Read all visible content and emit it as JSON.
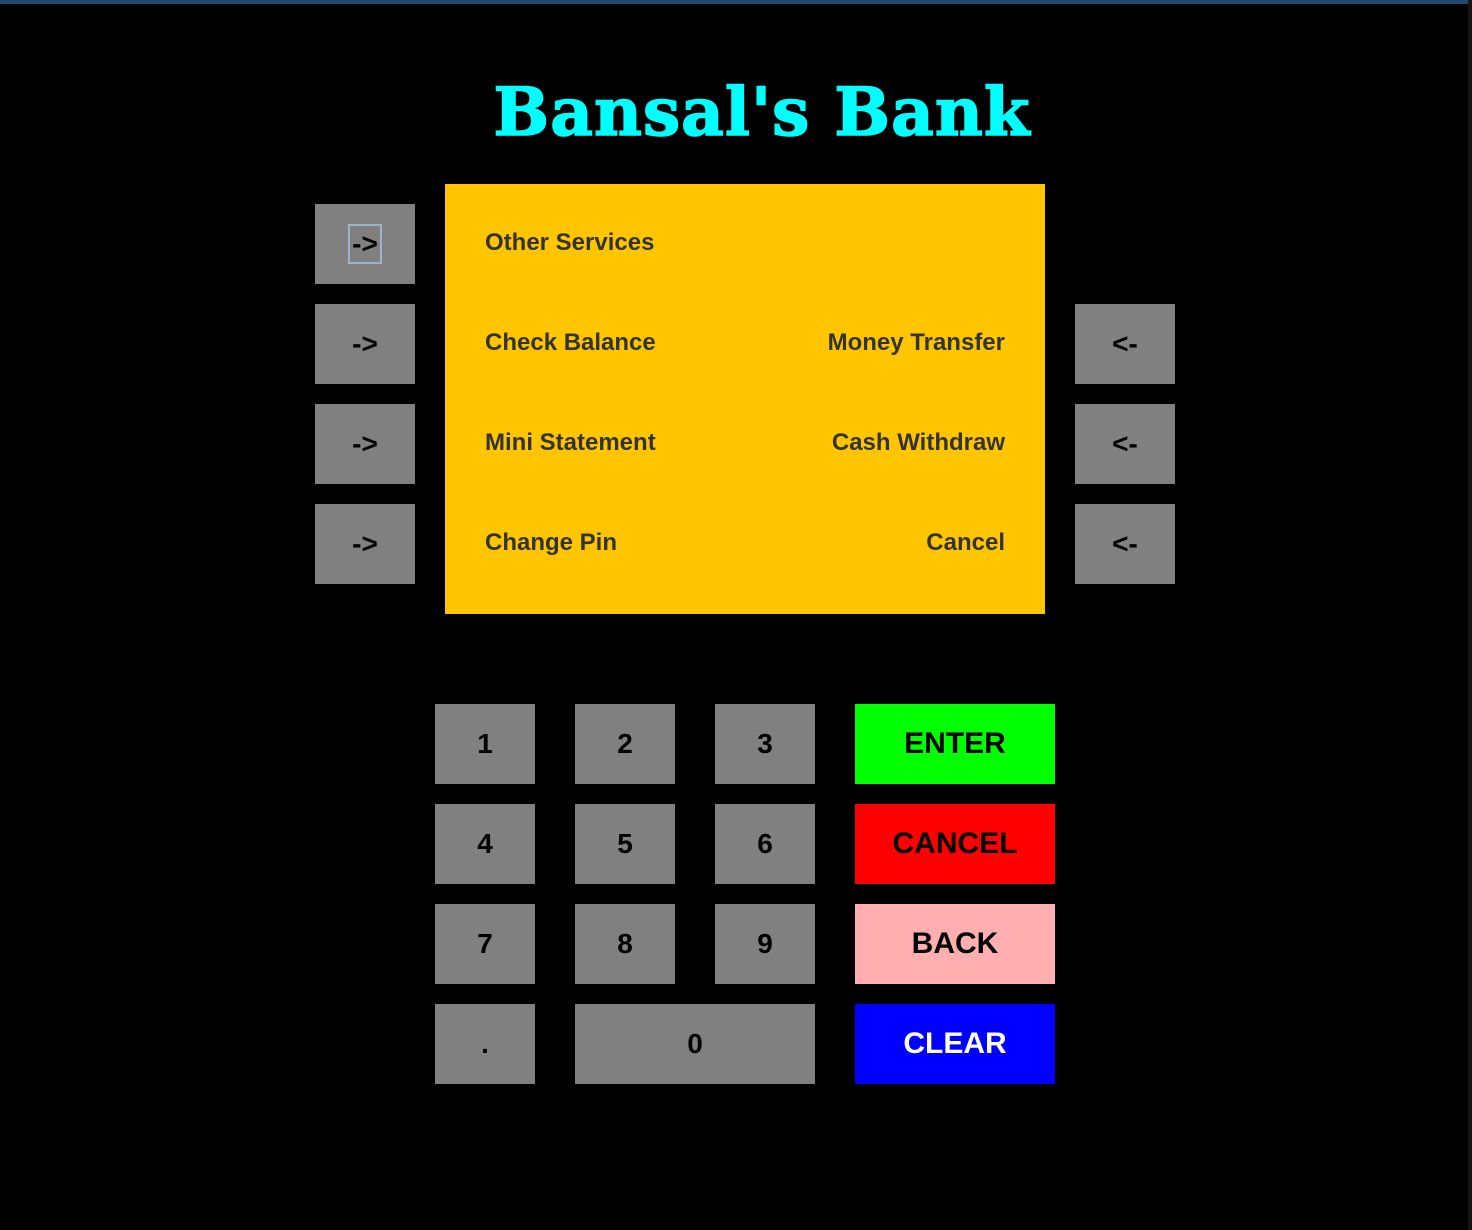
{
  "title": "Bansal's Bank",
  "screen": {
    "options": {
      "left_1": "Other Services",
      "left_2": "Check Balance",
      "left_3": "Mini Statement",
      "left_4": "Change Pin",
      "right_2": "Money Transfer",
      "right_3": "Cash Withdraw",
      "right_4": "Cancel"
    }
  },
  "side_buttons": {
    "left_label": "->",
    "right_label": "<-"
  },
  "keypad": {
    "keys": [
      "1",
      "2",
      "3",
      "4",
      "5",
      "6",
      "7",
      "8",
      "9",
      ".",
      "0"
    ]
  },
  "actions": {
    "enter": "ENTER",
    "cancel": "CANCEL",
    "back": "BACK",
    "clear": "CLEAR"
  },
  "colors": {
    "title": "#00ffff",
    "screen": "#ffc600",
    "key": "#808080",
    "enter": "#00ff00",
    "cancel": "#ff0000",
    "back": "#ffafaf",
    "clear": "#0000ff",
    "clear_text": "#ffffff"
  }
}
